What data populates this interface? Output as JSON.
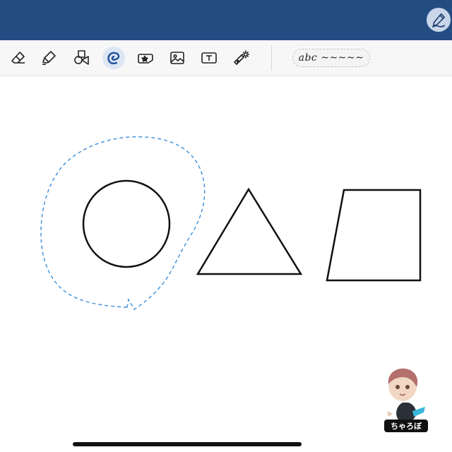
{
  "toolbar": {
    "tools": [
      {
        "name": "eraser",
        "icon": "eraser-icon",
        "active": false
      },
      {
        "name": "highlighter",
        "icon": "highlighter-icon",
        "active": false
      },
      {
        "name": "shapes",
        "icon": "shapes-icon",
        "active": false
      },
      {
        "name": "lasso",
        "icon": "lasso-icon",
        "active": true
      },
      {
        "name": "sticker",
        "icon": "sticker-icon",
        "active": false
      },
      {
        "name": "image",
        "icon": "image-icon",
        "active": false
      },
      {
        "name": "text",
        "icon": "text-box-icon",
        "active": false
      },
      {
        "name": "laser-pointer",
        "icon": "laser-pointer-icon",
        "active": false
      }
    ],
    "handwriting_chip_text": "abc ~~~~~",
    "active_color": "#1a4f9e"
  },
  "topbar": {
    "color": "#234d82",
    "pen_toggle_icon": "pen-icon"
  },
  "canvas": {
    "shapes": [
      "circle",
      "triangle",
      "trapezoid"
    ],
    "selection_color": "#3a8fdc"
  },
  "mascot": {
    "label": "ちゃろぼ"
  }
}
